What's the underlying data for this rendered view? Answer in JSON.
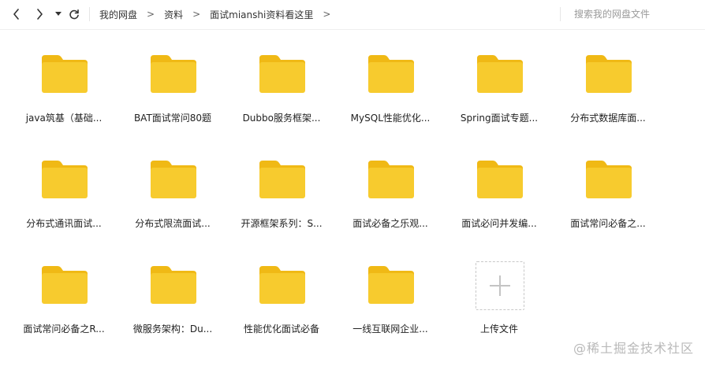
{
  "toolbar": {
    "back_icon": "chevron-left-icon",
    "forward_icon": "chevron-right-icon",
    "history_icon": "caret-down-icon",
    "refresh_icon": "refresh-icon"
  },
  "breadcrumb": {
    "items": [
      "我的网盘",
      "资料",
      "面试mianshi资料看这里"
    ],
    "separator": ">"
  },
  "search": {
    "placeholder": "搜索我的网盘文件"
  },
  "files": [
    {
      "label": "java筑基（基础..."
    },
    {
      "label": "BAT面试常问80题"
    },
    {
      "label": "Dubbo服务框架..."
    },
    {
      "label": "MySQL性能优化..."
    },
    {
      "label": "Spring面试专题..."
    },
    {
      "label": "分布式数据库面..."
    },
    {
      "label": "分布式通讯面试..."
    },
    {
      "label": "分布式限流面试..."
    },
    {
      "label": "开源框架系列：S..."
    },
    {
      "label": "面试必备之乐观..."
    },
    {
      "label": "面试必问并发编..."
    },
    {
      "label": "面试常问必备之..."
    },
    {
      "label": "面试常问必备之R..."
    },
    {
      "label": "微服务架构：Du..."
    },
    {
      "label": "性能优化面试必备"
    },
    {
      "label": "一线互联网企业..."
    }
  ],
  "upload": {
    "label": "上传文件",
    "icon": "plus-icon"
  },
  "watermark": {
    "text": "@稀土掘金技术社区"
  },
  "colors": {
    "folder_body": "#F7CB2E",
    "folder_tab": "#F0B915",
    "accent_text": "#333333"
  }
}
